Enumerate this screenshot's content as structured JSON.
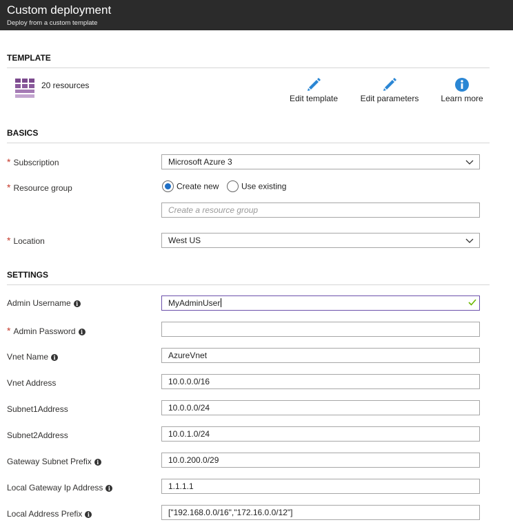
{
  "header": {
    "title": "Custom deployment",
    "subtitle": "Deploy from a custom template"
  },
  "template": {
    "heading": "TEMPLATE",
    "resource_icon": "grid-resources-icon",
    "resource_count": "20 resources",
    "actions": [
      {
        "label": "Edit template",
        "icon": "pencil-icon"
      },
      {
        "label": "Edit parameters",
        "icon": "pencil-icon"
      },
      {
        "label": "Learn more",
        "icon": "info-icon"
      }
    ]
  },
  "basics": {
    "heading": "BASICS",
    "subscription": {
      "label": "Subscription",
      "value": "Microsoft Azure 3"
    },
    "resource_group": {
      "label": "Resource group",
      "option_new": "Create new",
      "option_existing": "Use existing",
      "selected": "Create new",
      "placeholder": "Create a resource group"
    },
    "location": {
      "label": "Location",
      "value": "West US"
    }
  },
  "settings": {
    "heading": "SETTINGS",
    "admin_username": {
      "label": "Admin Username",
      "value": "MyAdminUser"
    },
    "admin_password": {
      "label": "Admin Password",
      "value": ""
    },
    "vnet_name": {
      "label": "Vnet Name",
      "value": "AzureVnet"
    },
    "vnet_address": {
      "label": "Vnet Address",
      "value": "10.0.0.0/16"
    },
    "subnet1": {
      "label": "Subnet1Address",
      "value": "10.0.0.0/24"
    },
    "subnet2": {
      "label": "Subnet2Address",
      "value": "10.0.1.0/24"
    },
    "gateway_subnet": {
      "label": "Gateway Subnet Prefix",
      "value": "10.0.200.0/29"
    },
    "local_gateway_ip": {
      "label": "Local Gateway Ip Address",
      "value": "1.1.1.1"
    },
    "local_address_prefix": {
      "label": "Local Address Prefix",
      "value": "[\"192.168.0.0/16\",\"172.16.0.0/12\"]"
    }
  },
  "colors": {
    "header_bg": "#2b2b2b",
    "required": "#c5382a",
    "accent_blue": "#2a86d4",
    "resource_purple": "#8a5a9c",
    "valid_green": "#6bb700"
  }
}
